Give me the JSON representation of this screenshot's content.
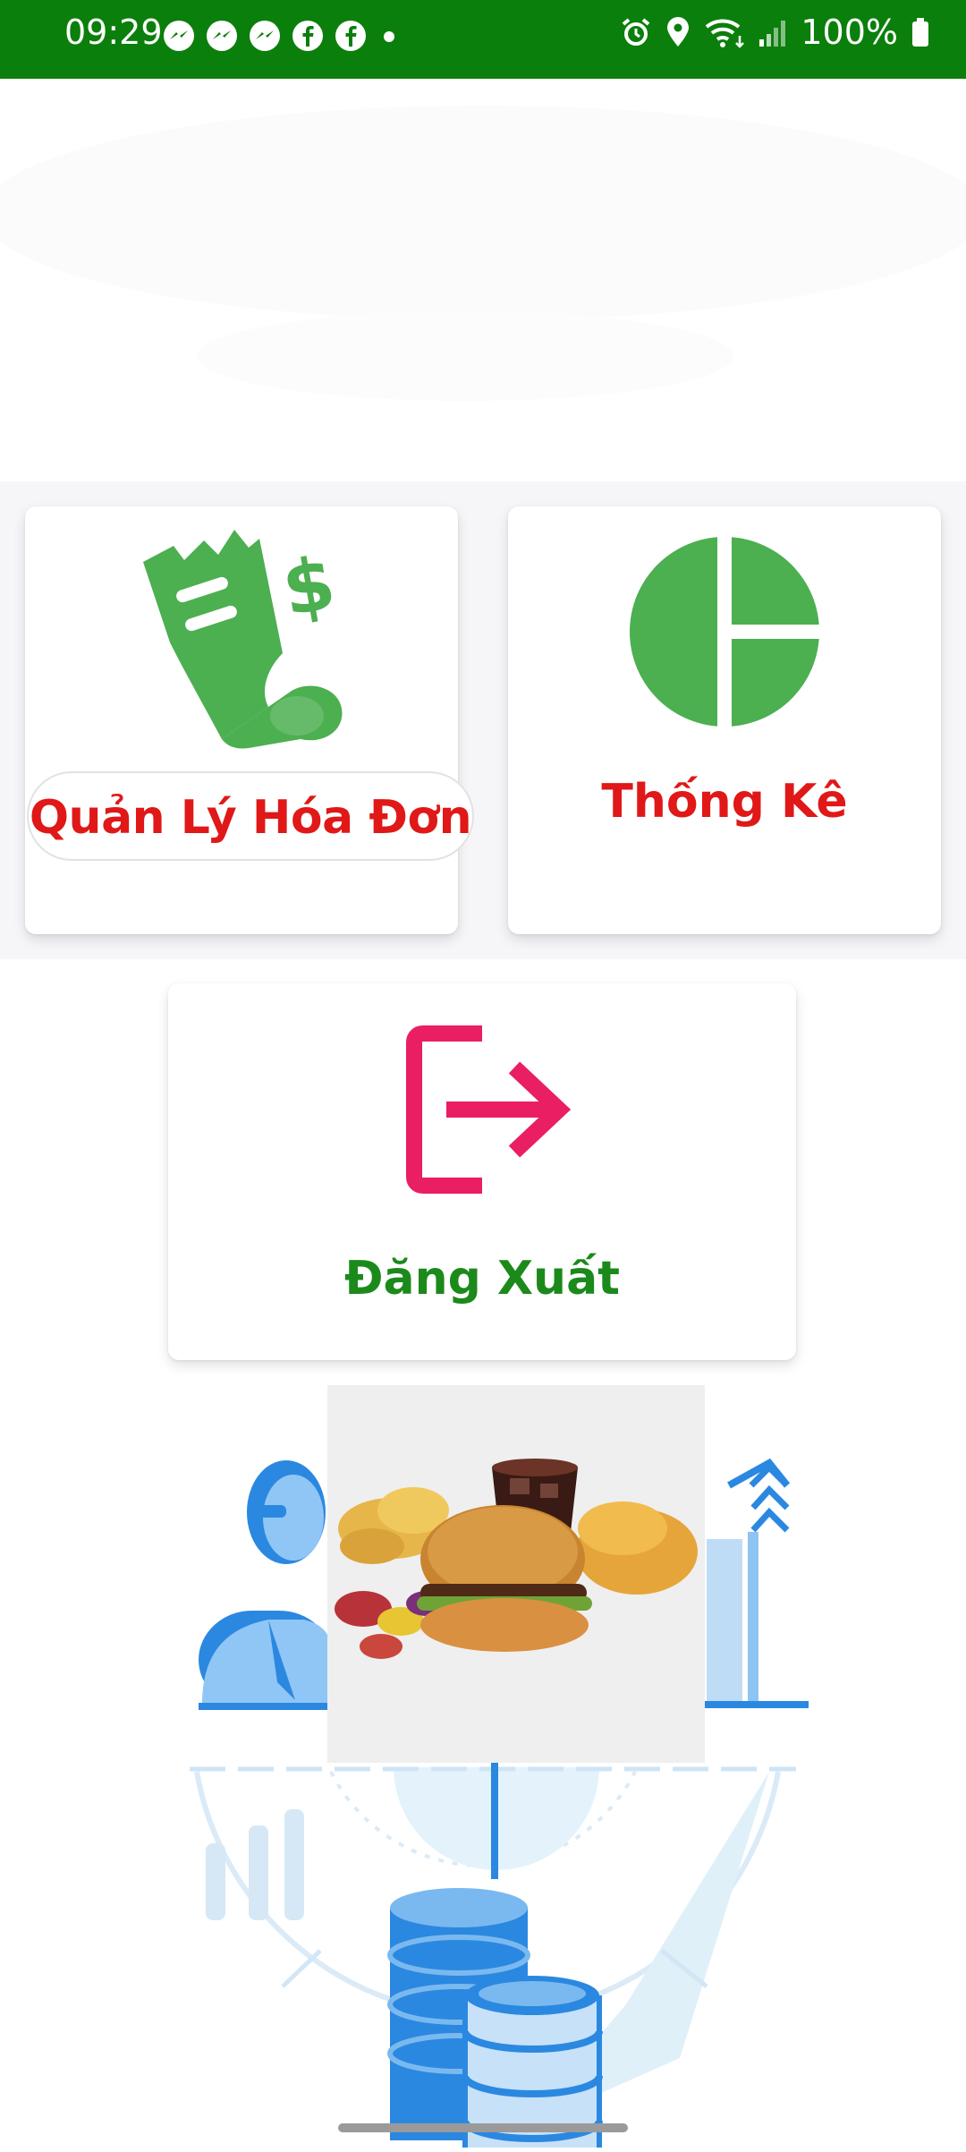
{
  "status_bar": {
    "time": "09:29",
    "notification_icons": [
      "messenger-icon",
      "messenger-icon",
      "messenger-icon",
      "facebook-icon",
      "facebook-icon",
      "dot-icon"
    ],
    "system_icons": [
      "alarm-icon",
      "location-icon",
      "wifi-icon",
      "signal-icon",
      "battery-icon"
    ],
    "battery": "100%",
    "background": "#0b7f0b"
  },
  "menu": {
    "invoice_label": "Quản Lý Hóa Đơn",
    "stats_label": "Thống Kê",
    "logout_label": "Đăng Xuất"
  },
  "colors": {
    "icon_green": "#4caf50",
    "label_red": "#e01818",
    "label_green": "#1b8a1b",
    "logout_icon": "#e91e63",
    "illustration_blue": "#2b88e0"
  }
}
